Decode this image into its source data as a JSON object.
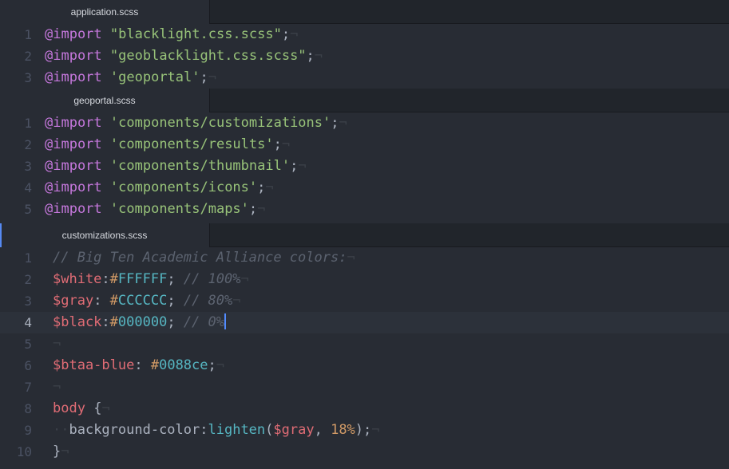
{
  "panes": [
    {
      "tab": "application.scss",
      "lines": [
        {
          "num": "1",
          "tokens": [
            {
              "t": "kw",
              "v": "@import"
            },
            {
              "t": "punc",
              "v": " "
            },
            {
              "t": "str",
              "v": "\"blacklight.css.scss\""
            },
            {
              "t": "punc",
              "v": ";"
            },
            {
              "t": "invis",
              "v": "¬"
            }
          ]
        },
        {
          "num": "2",
          "tokens": [
            {
              "t": "kw",
              "v": "@import"
            },
            {
              "t": "punc",
              "v": " "
            },
            {
              "t": "str",
              "v": "\"geoblacklight.css.scss\""
            },
            {
              "t": "punc",
              "v": ";"
            },
            {
              "t": "invis",
              "v": "¬"
            }
          ]
        },
        {
          "num": "3",
          "tokens": [
            {
              "t": "kw",
              "v": "@import"
            },
            {
              "t": "punc",
              "v": " "
            },
            {
              "t": "str",
              "v": "'geoportal'"
            },
            {
              "t": "punc",
              "v": ";"
            },
            {
              "t": "invis",
              "v": "¬"
            }
          ]
        }
      ]
    },
    {
      "tab": "geoportal.scss",
      "lines": [
        {
          "num": "1",
          "tokens": [
            {
              "t": "kw",
              "v": "@import"
            },
            {
              "t": "punc",
              "v": " "
            },
            {
              "t": "str",
              "v": "'components/customizations'"
            },
            {
              "t": "punc",
              "v": ";"
            },
            {
              "t": "invis",
              "v": "¬"
            }
          ]
        },
        {
          "num": "2",
          "tokens": [
            {
              "t": "kw",
              "v": "@import"
            },
            {
              "t": "punc",
              "v": " "
            },
            {
              "t": "str",
              "v": "'components/results'"
            },
            {
              "t": "punc",
              "v": ";"
            },
            {
              "t": "invis",
              "v": "¬"
            }
          ]
        },
        {
          "num": "3",
          "tokens": [
            {
              "t": "kw",
              "v": "@import"
            },
            {
              "t": "punc",
              "v": " "
            },
            {
              "t": "str",
              "v": "'components/thumbnail'"
            },
            {
              "t": "punc",
              "v": ";"
            },
            {
              "t": "invis",
              "v": "¬"
            }
          ]
        },
        {
          "num": "4",
          "tokens": [
            {
              "t": "kw",
              "v": "@import"
            },
            {
              "t": "punc",
              "v": " "
            },
            {
              "t": "str",
              "v": "'components/icons'"
            },
            {
              "t": "punc",
              "v": ";"
            },
            {
              "t": "invis",
              "v": "¬"
            }
          ]
        },
        {
          "num": "5",
          "tokens": [
            {
              "t": "kw",
              "v": "@import"
            },
            {
              "t": "punc",
              "v": " "
            },
            {
              "t": "str",
              "v": "'components/maps'"
            },
            {
              "t": "punc",
              "v": ";"
            },
            {
              "t": "invis",
              "v": "¬"
            }
          ]
        }
      ]
    },
    {
      "tab": "customizations.scss",
      "lines": [
        {
          "num": "1",
          "tokens": [
            {
              "t": "comment",
              "v": "// Big Ten Academic Alliance colors:"
            },
            {
              "t": "invis",
              "v": "¬"
            }
          ]
        },
        {
          "num": "2",
          "tokens": [
            {
              "t": "var",
              "v": "$white"
            },
            {
              "t": "punc",
              "v": ":"
            },
            {
              "t": "hash",
              "v": "#"
            },
            {
              "t": "hex",
              "v": "FFFFFF"
            },
            {
              "t": "punc",
              "v": "; "
            },
            {
              "t": "comment",
              "v": "// 100%"
            },
            {
              "t": "invis",
              "v": "¬"
            }
          ]
        },
        {
          "num": "3",
          "tokens": [
            {
              "t": "var",
              "v": "$gray"
            },
            {
              "t": "punc",
              "v": ": "
            },
            {
              "t": "hash",
              "v": "#"
            },
            {
              "t": "hex",
              "v": "CCCCCC"
            },
            {
              "t": "punc",
              "v": "; "
            },
            {
              "t": "comment",
              "v": "// 80%"
            },
            {
              "t": "invis",
              "v": "¬"
            }
          ]
        },
        {
          "num": "4",
          "tokens": [
            {
              "t": "var",
              "v": "$black"
            },
            {
              "t": "punc",
              "v": ":"
            },
            {
              "t": "hash",
              "v": "#"
            },
            {
              "t": "hex",
              "v": "000000"
            },
            {
              "t": "punc",
              "v": "; "
            },
            {
              "t": "comment",
              "v": "// 0%"
            },
            {
              "t": "cursor",
              "v": ""
            }
          ],
          "current": true
        },
        {
          "num": "5",
          "tokens": [
            {
              "t": "invis",
              "v": "¬"
            }
          ]
        },
        {
          "num": "6",
          "tokens": [
            {
              "t": "var",
              "v": "$btaa-blue"
            },
            {
              "t": "punc",
              "v": ": "
            },
            {
              "t": "hash",
              "v": "#"
            },
            {
              "t": "hex",
              "v": "0088ce"
            },
            {
              "t": "punc",
              "v": ";"
            },
            {
              "t": "invis",
              "v": "¬"
            }
          ]
        },
        {
          "num": "7",
          "tokens": [
            {
              "t": "invis",
              "v": "¬"
            }
          ]
        },
        {
          "num": "8",
          "tokens": [
            {
              "t": "sel",
              "v": "body"
            },
            {
              "t": "punc",
              "v": " {"
            },
            {
              "t": "invis",
              "v": "¬"
            }
          ]
        },
        {
          "num": "9",
          "tokens": [
            {
              "t": "invis",
              "v": "··"
            },
            {
              "t": "prop",
              "v": "background-color"
            },
            {
              "t": "punc",
              "v": ":"
            },
            {
              "t": "fn",
              "v": "lighten"
            },
            {
              "t": "punc",
              "v": "("
            },
            {
              "t": "var",
              "v": "$gray"
            },
            {
              "t": "punc",
              "v": ", "
            },
            {
              "t": "num",
              "v": "18%"
            },
            {
              "t": "punc",
              "v": ");"
            },
            {
              "t": "invis",
              "v": "¬"
            }
          ]
        },
        {
          "num": "10",
          "tokens": [
            {
              "t": "punc",
              "v": "}"
            },
            {
              "t": "invis",
              "v": "¬"
            }
          ]
        }
      ]
    }
  ]
}
